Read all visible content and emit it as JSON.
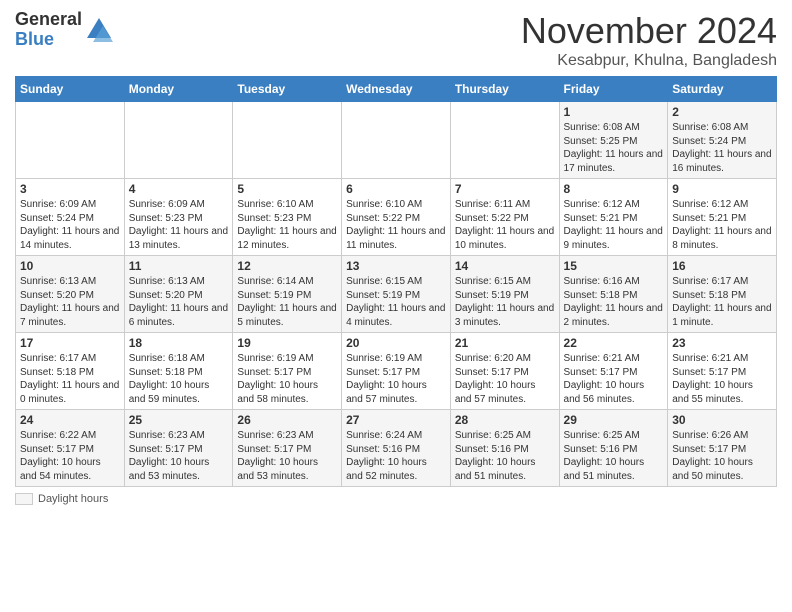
{
  "logo": {
    "general": "General",
    "blue": "Blue"
  },
  "title": "November 2024",
  "subtitle": "Kesabpur, Khulna, Bangladesh",
  "days_of_week": [
    "Sunday",
    "Monday",
    "Tuesday",
    "Wednesday",
    "Thursday",
    "Friday",
    "Saturday"
  ],
  "weeks": [
    [
      {
        "day": "",
        "info": ""
      },
      {
        "day": "",
        "info": ""
      },
      {
        "day": "",
        "info": ""
      },
      {
        "day": "",
        "info": ""
      },
      {
        "day": "",
        "info": ""
      },
      {
        "day": "1",
        "info": "Sunrise: 6:08 AM\nSunset: 5:25 PM\nDaylight: 11 hours and 17 minutes."
      },
      {
        "day": "2",
        "info": "Sunrise: 6:08 AM\nSunset: 5:24 PM\nDaylight: 11 hours and 16 minutes."
      }
    ],
    [
      {
        "day": "3",
        "info": "Sunrise: 6:09 AM\nSunset: 5:24 PM\nDaylight: 11 hours and 14 minutes."
      },
      {
        "day": "4",
        "info": "Sunrise: 6:09 AM\nSunset: 5:23 PM\nDaylight: 11 hours and 13 minutes."
      },
      {
        "day": "5",
        "info": "Sunrise: 6:10 AM\nSunset: 5:23 PM\nDaylight: 11 hours and 12 minutes."
      },
      {
        "day": "6",
        "info": "Sunrise: 6:10 AM\nSunset: 5:22 PM\nDaylight: 11 hours and 11 minutes."
      },
      {
        "day": "7",
        "info": "Sunrise: 6:11 AM\nSunset: 5:22 PM\nDaylight: 11 hours and 10 minutes."
      },
      {
        "day": "8",
        "info": "Sunrise: 6:12 AM\nSunset: 5:21 PM\nDaylight: 11 hours and 9 minutes."
      },
      {
        "day": "9",
        "info": "Sunrise: 6:12 AM\nSunset: 5:21 PM\nDaylight: 11 hours and 8 minutes."
      }
    ],
    [
      {
        "day": "10",
        "info": "Sunrise: 6:13 AM\nSunset: 5:20 PM\nDaylight: 11 hours and 7 minutes."
      },
      {
        "day": "11",
        "info": "Sunrise: 6:13 AM\nSunset: 5:20 PM\nDaylight: 11 hours and 6 minutes."
      },
      {
        "day": "12",
        "info": "Sunrise: 6:14 AM\nSunset: 5:19 PM\nDaylight: 11 hours and 5 minutes."
      },
      {
        "day": "13",
        "info": "Sunrise: 6:15 AM\nSunset: 5:19 PM\nDaylight: 11 hours and 4 minutes."
      },
      {
        "day": "14",
        "info": "Sunrise: 6:15 AM\nSunset: 5:19 PM\nDaylight: 11 hours and 3 minutes."
      },
      {
        "day": "15",
        "info": "Sunrise: 6:16 AM\nSunset: 5:18 PM\nDaylight: 11 hours and 2 minutes."
      },
      {
        "day": "16",
        "info": "Sunrise: 6:17 AM\nSunset: 5:18 PM\nDaylight: 11 hours and 1 minute."
      }
    ],
    [
      {
        "day": "17",
        "info": "Sunrise: 6:17 AM\nSunset: 5:18 PM\nDaylight: 11 hours and 0 minutes."
      },
      {
        "day": "18",
        "info": "Sunrise: 6:18 AM\nSunset: 5:18 PM\nDaylight: 10 hours and 59 minutes."
      },
      {
        "day": "19",
        "info": "Sunrise: 6:19 AM\nSunset: 5:17 PM\nDaylight: 10 hours and 58 minutes."
      },
      {
        "day": "20",
        "info": "Sunrise: 6:19 AM\nSunset: 5:17 PM\nDaylight: 10 hours and 57 minutes."
      },
      {
        "day": "21",
        "info": "Sunrise: 6:20 AM\nSunset: 5:17 PM\nDaylight: 10 hours and 57 minutes."
      },
      {
        "day": "22",
        "info": "Sunrise: 6:21 AM\nSunset: 5:17 PM\nDaylight: 10 hours and 56 minutes."
      },
      {
        "day": "23",
        "info": "Sunrise: 6:21 AM\nSunset: 5:17 PM\nDaylight: 10 hours and 55 minutes."
      }
    ],
    [
      {
        "day": "24",
        "info": "Sunrise: 6:22 AM\nSunset: 5:17 PM\nDaylight: 10 hours and 54 minutes."
      },
      {
        "day": "25",
        "info": "Sunrise: 6:23 AM\nSunset: 5:17 PM\nDaylight: 10 hours and 53 minutes."
      },
      {
        "day": "26",
        "info": "Sunrise: 6:23 AM\nSunset: 5:17 PM\nDaylight: 10 hours and 53 minutes."
      },
      {
        "day": "27",
        "info": "Sunrise: 6:24 AM\nSunset: 5:16 PM\nDaylight: 10 hours and 52 minutes."
      },
      {
        "day": "28",
        "info": "Sunrise: 6:25 AM\nSunset: 5:16 PM\nDaylight: 10 hours and 51 minutes."
      },
      {
        "day": "29",
        "info": "Sunrise: 6:25 AM\nSunset: 5:16 PM\nDaylight: 10 hours and 51 minutes."
      },
      {
        "day": "30",
        "info": "Sunrise: 6:26 AM\nSunset: 5:17 PM\nDaylight: 10 hours and 50 minutes."
      }
    ]
  ],
  "legend": "Daylight hours"
}
